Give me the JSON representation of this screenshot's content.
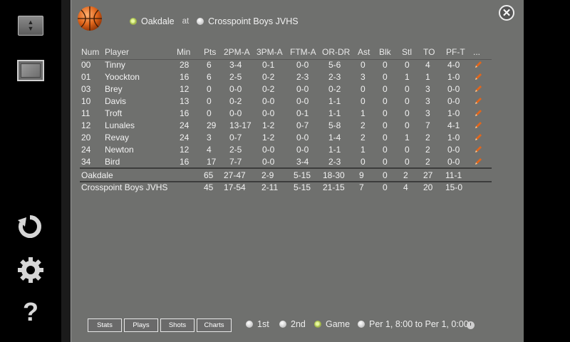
{
  "header": {
    "home_team": "Oakdale",
    "at": "at",
    "away_team": "Crosspoint Boys JVHS"
  },
  "columns": [
    "Num",
    "Player",
    "Min",
    "Pts",
    "2PM-A",
    "3PM-A",
    "FTM-A",
    "OR-DR",
    "Ast",
    "Blk",
    "Stl",
    "TO",
    "PF-T",
    "..."
  ],
  "players": [
    {
      "num": "00",
      "name": "Tinny",
      "min": "28",
      "pts": "6",
      "p2": "3-4",
      "p3": "0-1",
      "ft": "0-0",
      "reb": "5-6",
      "ast": "0",
      "blk": "0",
      "stl": "0",
      "to": "4",
      "pf": "4-0"
    },
    {
      "num": "01",
      "name": "Yoockton",
      "min": "16",
      "pts": "6",
      "p2": "2-5",
      "p3": "0-2",
      "ft": "2-3",
      "reb": "2-3",
      "ast": "3",
      "blk": "0",
      "stl": "1",
      "to": "1",
      "pf": "1-0"
    },
    {
      "num": "03",
      "name": "Brey",
      "min": "12",
      "pts": "0",
      "p2": "0-0",
      "p3": "0-2",
      "ft": "0-0",
      "reb": "0-2",
      "ast": "0",
      "blk": "0",
      "stl": "0",
      "to": "3",
      "pf": "0-0"
    },
    {
      "num": "10",
      "name": "Davis",
      "min": "13",
      "pts": "0",
      "p2": "0-2",
      "p3": "0-0",
      "ft": "0-0",
      "reb": "1-1",
      "ast": "0",
      "blk": "0",
      "stl": "0",
      "to": "3",
      "pf": "0-0"
    },
    {
      "num": "11",
      "name": "Troft",
      "min": "16",
      "pts": "0",
      "p2": "0-0",
      "p3": "0-0",
      "ft": "0-1",
      "reb": "1-1",
      "ast": "1",
      "blk": "0",
      "stl": "0",
      "to": "3",
      "pf": "1-0"
    },
    {
      "num": "12",
      "name": "Lunales",
      "min": "24",
      "pts": "29",
      "p2": "13-17",
      "p3": "1-2",
      "ft": "0-7",
      "reb": "5-8",
      "ast": "2",
      "blk": "0",
      "stl": "0",
      "to": "7",
      "pf": "4-1"
    },
    {
      "num": "20",
      "name": "Revay",
      "min": "24",
      "pts": "3",
      "p2": "0-7",
      "p3": "1-2",
      "ft": "0-0",
      "reb": "1-4",
      "ast": "2",
      "blk": "0",
      "stl": "1",
      "to": "2",
      "pf": "1-0"
    },
    {
      "num": "24",
      "name": "Newton",
      "min": "12",
      "pts": "4",
      "p2": "2-5",
      "p3": "0-0",
      "ft": "0-0",
      "reb": "1-1",
      "ast": "1",
      "blk": "0",
      "stl": "0",
      "to": "2",
      "pf": "0-0"
    },
    {
      "num": "34",
      "name": "Bird",
      "min": "16",
      "pts": "17",
      "p2": "7-7",
      "p3": "0-0",
      "ft": "3-4",
      "reb": "2-3",
      "ast": "0",
      "blk": "0",
      "stl": "0",
      "to": "2",
      "pf": "0-0"
    }
  ],
  "totals": [
    {
      "team": "Oakdale",
      "pts": "65",
      "p2": "27-47",
      "p3": "2-9",
      "ft": "5-15",
      "reb": "18-30",
      "ast": "9",
      "blk": "0",
      "stl": "2",
      "to": "27",
      "pf": "11-1"
    },
    {
      "team": "Crosspoint Boys JVHS",
      "pts": "45",
      "p2": "17-54",
      "p3": "2-11",
      "ft": "5-15",
      "reb": "21-15",
      "ast": "7",
      "blk": "0",
      "stl": "4",
      "to": "20",
      "pf": "15-0"
    }
  ],
  "tabs": {
    "stats": "Stats",
    "plays": "Plays",
    "shots": "Shots",
    "charts": "Charts"
  },
  "periods": {
    "first": "1st",
    "second": "2nd",
    "game": "Game",
    "range": "Per 1, 8:00 to Per 1, 0:00"
  },
  "help_glyph": "?",
  "close_glyph": "✕",
  "icons": {
    "refresh": "refresh-icon",
    "settings": "gear-icon",
    "help": "help-icon",
    "edit": "pencil-icon"
  }
}
